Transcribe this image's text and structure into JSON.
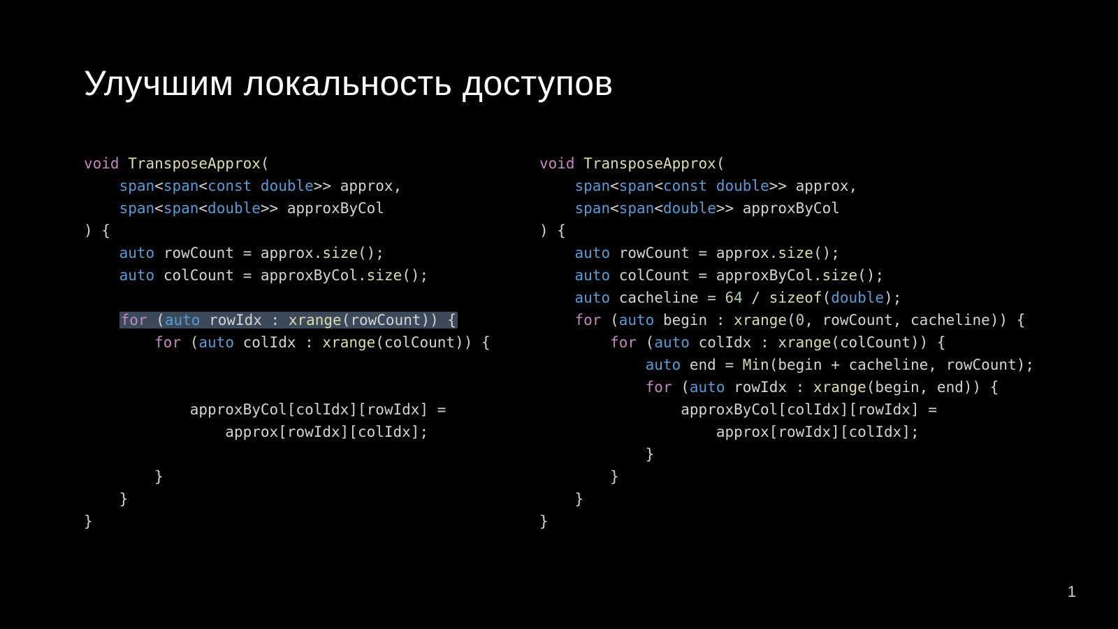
{
  "title": "Улучшим локальность доступов",
  "page_number": "1",
  "code_left": {
    "l1": {
      "kw": "void",
      "fn": "TransposeApprox",
      "tail": "("
    },
    "l2": {
      "tp1": "span",
      "op1": "<",
      "tp2": "span",
      "op2": "<",
      "tp3": "const",
      "sp": " ",
      "tp4": "double",
      "op3": ">> ",
      "id": "approx",
      "op4": ","
    },
    "l3": {
      "tp1": "span",
      "op1": "<",
      "tp2": "span",
      "op2": "<",
      "tp3": "double",
      "op3": ">> ",
      "id": "approxByCol"
    },
    "l4": ") {",
    "l5": {
      "tp": "auto",
      "id": "rowCount",
      "eq": " = ",
      "rhs": "approx",
      "dot": ".",
      "fn": "size",
      "tail": "();"
    },
    "l6": {
      "tp": "auto",
      "id": "colCount",
      "eq": " = ",
      "rhs": "approxByCol",
      "dot": ".",
      "fn": "size",
      "tail": "();"
    },
    "l8": {
      "kw": "for",
      "op1": " (",
      "tp": "auto",
      "sp": " ",
      "id": "rowIdx",
      "op2": " : ",
      "fn": "xrange",
      "args": "(rowCount)) {"
    },
    "l9": {
      "kw": "for",
      "op1": " (",
      "tp": "auto",
      "sp": " ",
      "id": "colIdx",
      "op2": " : ",
      "fn": "xrange",
      "args": "(colCount)) {"
    },
    "l12": "approxByCol[colIdx][rowIdx] =",
    "l13": "approx[rowIdx][colIdx];",
    "l15": "}",
    "l16": "}",
    "l17": "}"
  },
  "code_right": {
    "l1": {
      "kw": "void",
      "fn": "TransposeApprox",
      "tail": "("
    },
    "l2": {
      "tp1": "span",
      "op1": "<",
      "tp2": "span",
      "op2": "<",
      "tp3": "const",
      "sp": " ",
      "tp4": "double",
      "op3": ">> ",
      "id": "approx",
      "op4": ","
    },
    "l3": {
      "tp1": "span",
      "op1": "<",
      "tp2": "span",
      "op2": "<",
      "tp3": "double",
      "op3": ">> ",
      "id": "approxByCol"
    },
    "l4": ") {",
    "l5": {
      "tp": "auto",
      "id": "rowCount",
      "eq": " = ",
      "rhs": "approx",
      "dot": ".",
      "fn": "size",
      "tail": "();"
    },
    "l6": {
      "tp": "auto",
      "id": "colCount",
      "eq": " = ",
      "rhs": "approxByCol",
      "dot": ".",
      "fn": "size",
      "tail": "();"
    },
    "l7": {
      "tp": "auto",
      "id": "cacheline",
      "eq": " = ",
      "n1": "64",
      "op": " / ",
      "fn": "sizeof",
      "args": "(",
      "tp2": "double",
      "tail": ");"
    },
    "l8": {
      "kw": "for",
      "op1": " (",
      "tp": "auto",
      "sp": " ",
      "id": "begin",
      "op2": " : ",
      "fn": "xrange",
      "args": "(",
      "n": "0",
      "rest": ", rowCount, cacheline)) {"
    },
    "l9": {
      "kw": "for",
      "op1": " (",
      "tp": "auto",
      "sp": " ",
      "id": "colIdx",
      "op2": " : ",
      "fn": "xrange",
      "args": "(colCount)) {"
    },
    "l10": {
      "tp": "auto",
      "id": "end",
      "eq": " = ",
      "fn": "Min",
      "args": "(begin + cacheline, rowCount);"
    },
    "l11": {
      "kw": "for",
      "op1": " (",
      "tp": "auto",
      "sp": " ",
      "id": "rowIdx",
      "op2": " : ",
      "fn": "xrange",
      "args": "(begin, end)) {"
    },
    "l12": "approxByCol[colIdx][rowIdx] =",
    "l13": "approx[rowIdx][colIdx];",
    "l14": "}",
    "l15": "}",
    "l16": "}",
    "l17": "}"
  }
}
